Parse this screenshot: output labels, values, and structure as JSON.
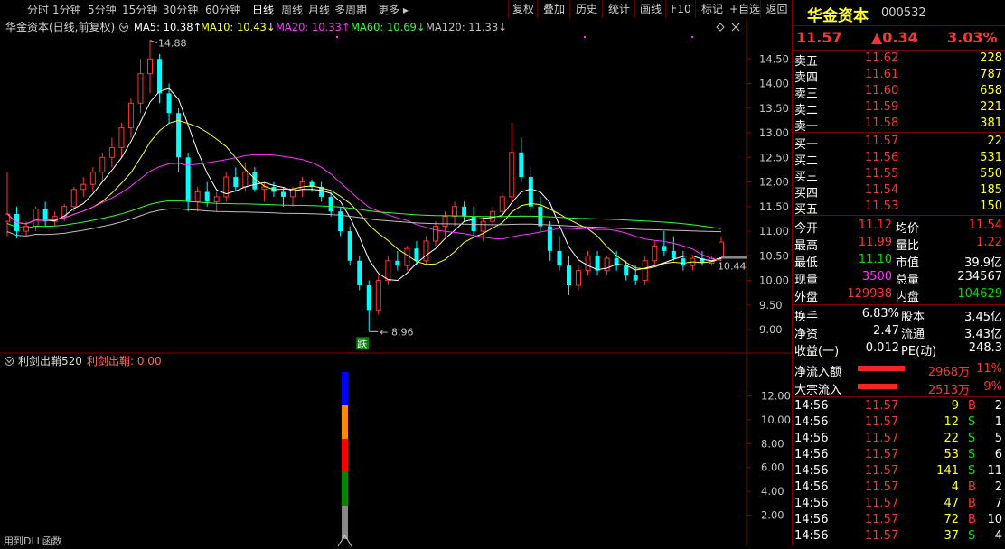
{
  "toolbar": {
    "periods": [
      "分时",
      "1分钟",
      "5分钟",
      "15分钟",
      "30分钟",
      "60分钟",
      "日线",
      "周线",
      "月线",
      "多周期",
      "更多"
    ],
    "active_period": "日线",
    "buttons": [
      "复权",
      "叠加",
      "历史",
      "统计",
      "画线",
      "F10",
      "标记",
      "+自选",
      "返回"
    ]
  },
  "main_chart": {
    "title": "华金资本(日线,前复权)",
    "ma_labels": [
      {
        "text": "MA5: 10.38↑",
        "color": "#ffffff"
      },
      {
        "text": "MA10: 10.43↓",
        "color": "#ffff33"
      },
      {
        "text": "MA20: 10.33↑",
        "color": "#ff33ff"
      },
      {
        "text": "MA60: 10.69↓",
        "color": "#33ff33"
      },
      {
        "text": "MA120: 11.33↓",
        "color": "#c0c0c0"
      }
    ],
    "high_label": "14.88",
    "low_label": "8.96",
    "current_label": "10.44",
    "signal_label": "跌"
  },
  "sub_chart": {
    "title": "利剑出鞘520",
    "indicator_label": "利剑出鞘: 0.00",
    "footer": "用到DLL函数"
  },
  "chart_data": [
    {
      "type": "candlestick",
      "y_axis_ticks": [
        "14.50",
        "14.00",
        "13.50",
        "13.00",
        "12.50",
        "12.00",
        "11.50",
        "11.00",
        "10.50",
        "10.00",
        "9.50",
        "9.00"
      ],
      "ylim": [
        8.8,
        15.0
      ],
      "colors": {
        "up": "#ff3333",
        "down": "#00ffff",
        "ma5": "#ffffff",
        "ma10": "#ffff33",
        "ma20": "#ff33ff",
        "ma60": "#33ff33",
        "ma120": "#c0c0c0"
      },
      "candles": [
        [
          11.2,
          12.2,
          10.9,
          11.35
        ],
        [
          11.35,
          11.5,
          10.85,
          11.0
        ],
        [
          11.0,
          11.2,
          10.9,
          11.1
        ],
        [
          11.1,
          11.5,
          11.0,
          11.45
        ],
        [
          11.45,
          11.6,
          11.1,
          11.2
        ],
        [
          11.2,
          11.4,
          11.1,
          11.3
        ],
        [
          11.3,
          11.55,
          11.2,
          11.5
        ],
        [
          11.5,
          11.9,
          11.4,
          11.85
        ],
        [
          11.85,
          12.1,
          11.7,
          11.95
        ],
        [
          11.95,
          12.3,
          11.8,
          12.2
        ],
        [
          12.2,
          12.6,
          12.0,
          12.5
        ],
        [
          12.5,
          12.9,
          12.3,
          12.7
        ],
        [
          12.7,
          13.2,
          12.5,
          13.1
        ],
        [
          13.1,
          13.7,
          12.9,
          13.6
        ],
        [
          13.6,
          14.5,
          13.4,
          14.2
        ],
        [
          14.2,
          14.88,
          13.8,
          14.5
        ],
        [
          14.5,
          14.6,
          13.6,
          13.8
        ],
        [
          13.8,
          14.0,
          13.2,
          13.4
        ],
        [
          13.4,
          13.5,
          12.2,
          12.5
        ],
        [
          12.5,
          12.6,
          11.4,
          11.6
        ],
        [
          11.6,
          11.9,
          11.4,
          11.8
        ],
        [
          11.8,
          12.0,
          11.5,
          11.6
        ],
        [
          11.6,
          11.8,
          11.4,
          11.7
        ],
        [
          11.7,
          12.2,
          11.6,
          12.1
        ],
        [
          12.1,
          12.3,
          11.8,
          11.9
        ],
        [
          11.9,
          12.4,
          11.8,
          12.2
        ],
        [
          12.2,
          12.3,
          11.8,
          11.85
        ],
        [
          11.85,
          12.0,
          11.6,
          11.9
        ],
        [
          11.9,
          12.0,
          11.7,
          11.8
        ],
        [
          11.8,
          11.9,
          11.5,
          11.7
        ],
        [
          11.7,
          11.9,
          11.5,
          11.85
        ],
        [
          11.85,
          12.1,
          11.7,
          12.0
        ],
        [
          12.0,
          12.05,
          11.8,
          11.9
        ],
        [
          11.9,
          12.0,
          11.6,
          11.7
        ],
        [
          11.7,
          11.8,
          11.3,
          11.4
        ],
        [
          11.4,
          11.5,
          10.9,
          11.0
        ],
        [
          11.0,
          11.1,
          10.3,
          10.4
        ],
        [
          10.4,
          10.5,
          9.8,
          9.9
        ],
        [
          9.9,
          10.0,
          8.96,
          9.4
        ],
        [
          9.4,
          10.1,
          9.3,
          10.0
        ],
        [
          10.0,
          10.5,
          9.9,
          10.4
        ],
        [
          10.4,
          10.6,
          10.2,
          10.3
        ],
        [
          10.3,
          10.7,
          10.2,
          10.65
        ],
        [
          10.65,
          10.8,
          10.3,
          10.4
        ],
        [
          10.4,
          10.9,
          10.3,
          10.8
        ],
        [
          10.8,
          11.2,
          10.7,
          11.1
        ],
        [
          11.1,
          11.4,
          10.9,
          11.3
        ],
        [
          11.3,
          11.6,
          11.1,
          11.5
        ],
        [
          11.5,
          11.6,
          11.2,
          11.3
        ],
        [
          11.3,
          11.5,
          10.9,
          11.0
        ],
        [
          11.0,
          11.3,
          10.8,
          11.2
        ],
        [
          11.2,
          11.5,
          11.1,
          11.4
        ],
        [
          11.4,
          11.8,
          11.3,
          11.7
        ],
        [
          11.7,
          13.2,
          11.6,
          12.6
        ],
        [
          12.6,
          12.9,
          12.0,
          12.1
        ],
        [
          12.1,
          12.3,
          11.4,
          11.5
        ],
        [
          11.5,
          11.7,
          11.0,
          11.1
        ],
        [
          11.1,
          11.2,
          10.4,
          10.6
        ],
        [
          10.6,
          10.9,
          10.2,
          10.3
        ],
        [
          10.3,
          10.5,
          9.7,
          9.9
        ],
        [
          9.9,
          10.3,
          9.8,
          10.2
        ],
        [
          10.2,
          10.6,
          10.1,
          10.5
        ],
        [
          10.5,
          10.6,
          10.1,
          10.2
        ],
        [
          10.2,
          10.5,
          10.1,
          10.45
        ],
        [
          10.45,
          10.6,
          10.2,
          10.3
        ],
        [
          10.3,
          10.4,
          10.0,
          10.1
        ],
        [
          10.1,
          10.3,
          9.9,
          10.0
        ],
        [
          10.0,
          10.5,
          9.9,
          10.4
        ],
        [
          10.4,
          10.8,
          10.3,
          10.7
        ],
        [
          10.7,
          11.0,
          10.5,
          10.6
        ],
        [
          10.6,
          10.9,
          10.4,
          10.45
        ],
        [
          10.45,
          10.6,
          10.2,
          10.3
        ],
        [
          10.3,
          10.5,
          10.2,
          10.45
        ],
        [
          10.45,
          10.6,
          10.3,
          10.35
        ],
        [
          10.35,
          10.5,
          10.3,
          10.45
        ],
        [
          10.45,
          10.9,
          10.4,
          10.78
        ]
      ]
    },
    {
      "type": "bar",
      "y_axis_ticks": [
        "12.00",
        "10.00",
        "8.00",
        "6.00",
        "4.00",
        "2.00"
      ],
      "ylim": [
        0,
        14
      ],
      "series": [
        {
          "values": [
            14
          ]
        }
      ],
      "segment_colors": [
        "#0000ff",
        "#ff8800",
        "#ff0000",
        "#008800",
        "#888888"
      ]
    }
  ],
  "quote": {
    "name": "华金资本",
    "code": "000532",
    "price": "11.57",
    "change": "▲0.34",
    "pct": "3.03%",
    "asks": [
      {
        "label": "卖五",
        "price": "11.62",
        "vol": "228"
      },
      {
        "label": "卖四",
        "price": "11.61",
        "vol": "787"
      },
      {
        "label": "卖三",
        "price": "11.60",
        "vol": "658"
      },
      {
        "label": "卖二",
        "price": "11.59",
        "vol": "221"
      },
      {
        "label": "卖一",
        "price": "11.58",
        "vol": "381"
      }
    ],
    "bids": [
      {
        "label": "买一",
        "price": "11.57",
        "vol": "22"
      },
      {
        "label": "买二",
        "price": "11.56",
        "vol": "531"
      },
      {
        "label": "买三",
        "price": "11.55",
        "vol": "550"
      },
      {
        "label": "买四",
        "price": "11.54",
        "vol": "185"
      },
      {
        "label": "买五",
        "price": "11.53",
        "vol": "150"
      }
    ],
    "stats1": [
      {
        "l1": "今开",
        "v1": "11.12",
        "c1": "red",
        "l2": "均价",
        "v2": "11.54",
        "c2": "red"
      },
      {
        "l1": "最高",
        "v1": "11.99",
        "c1": "red",
        "l2": "量比",
        "v2": "1.22",
        "c2": "red"
      },
      {
        "l1": "最低",
        "v1": "11.10",
        "c1": "green",
        "l2": "市值",
        "v2": "39.9亿",
        "c2": "white"
      },
      {
        "l1": "现量",
        "v1": "3500",
        "c1": "purple",
        "l2": "总量",
        "v2": "234567",
        "c2": "white"
      },
      {
        "l1": "外盘",
        "v1": "129938",
        "c1": "red",
        "l2": "内盘",
        "v2": "104629",
        "c2": "green"
      }
    ],
    "stats2": [
      {
        "l1": "换手",
        "v1": "6.83%",
        "l2": "股本",
        "v2": "3.45亿"
      },
      {
        "l1": "净资",
        "v1": "2.47",
        "l2": "流通",
        "v2": "3.43亿"
      },
      {
        "l1": "收益(一)",
        "v1": "0.012",
        "l2": "PE(动)",
        "v2": "248.3"
      }
    ],
    "flows": [
      {
        "label": "净流入额",
        "value": "2968万",
        "pct": "11%",
        "bar": 0.52
      },
      {
        "label": "大宗流入",
        "value": "2513万",
        "pct": "9%",
        "bar": 0.44
      }
    ],
    "ticks": [
      {
        "time": "14:56",
        "price": "11.57",
        "vol": "9",
        "side": "B",
        "num": "2"
      },
      {
        "time": "14:56",
        "price": "11.57",
        "vol": "12",
        "side": "S",
        "num": "1"
      },
      {
        "time": "14:56",
        "price": "11.57",
        "vol": "22",
        "side": "S",
        "num": "5"
      },
      {
        "time": "14:56",
        "price": "11.57",
        "vol": "53",
        "side": "S",
        "num": "6"
      },
      {
        "time": "14:56",
        "price": "11.57",
        "vol": "141",
        "side": "S",
        "num": "11"
      },
      {
        "time": "14:56",
        "price": "11.57",
        "vol": "4",
        "side": "B",
        "num": "2"
      },
      {
        "time": "14:56",
        "price": "11.57",
        "vol": "47",
        "side": "B",
        "num": "7"
      },
      {
        "time": "14:56",
        "price": "11.57",
        "vol": "72",
        "side": "B",
        "num": "10"
      },
      {
        "time": "14:56",
        "price": "11.57",
        "vol": "37",
        "side": "S",
        "num": "4"
      }
    ]
  }
}
